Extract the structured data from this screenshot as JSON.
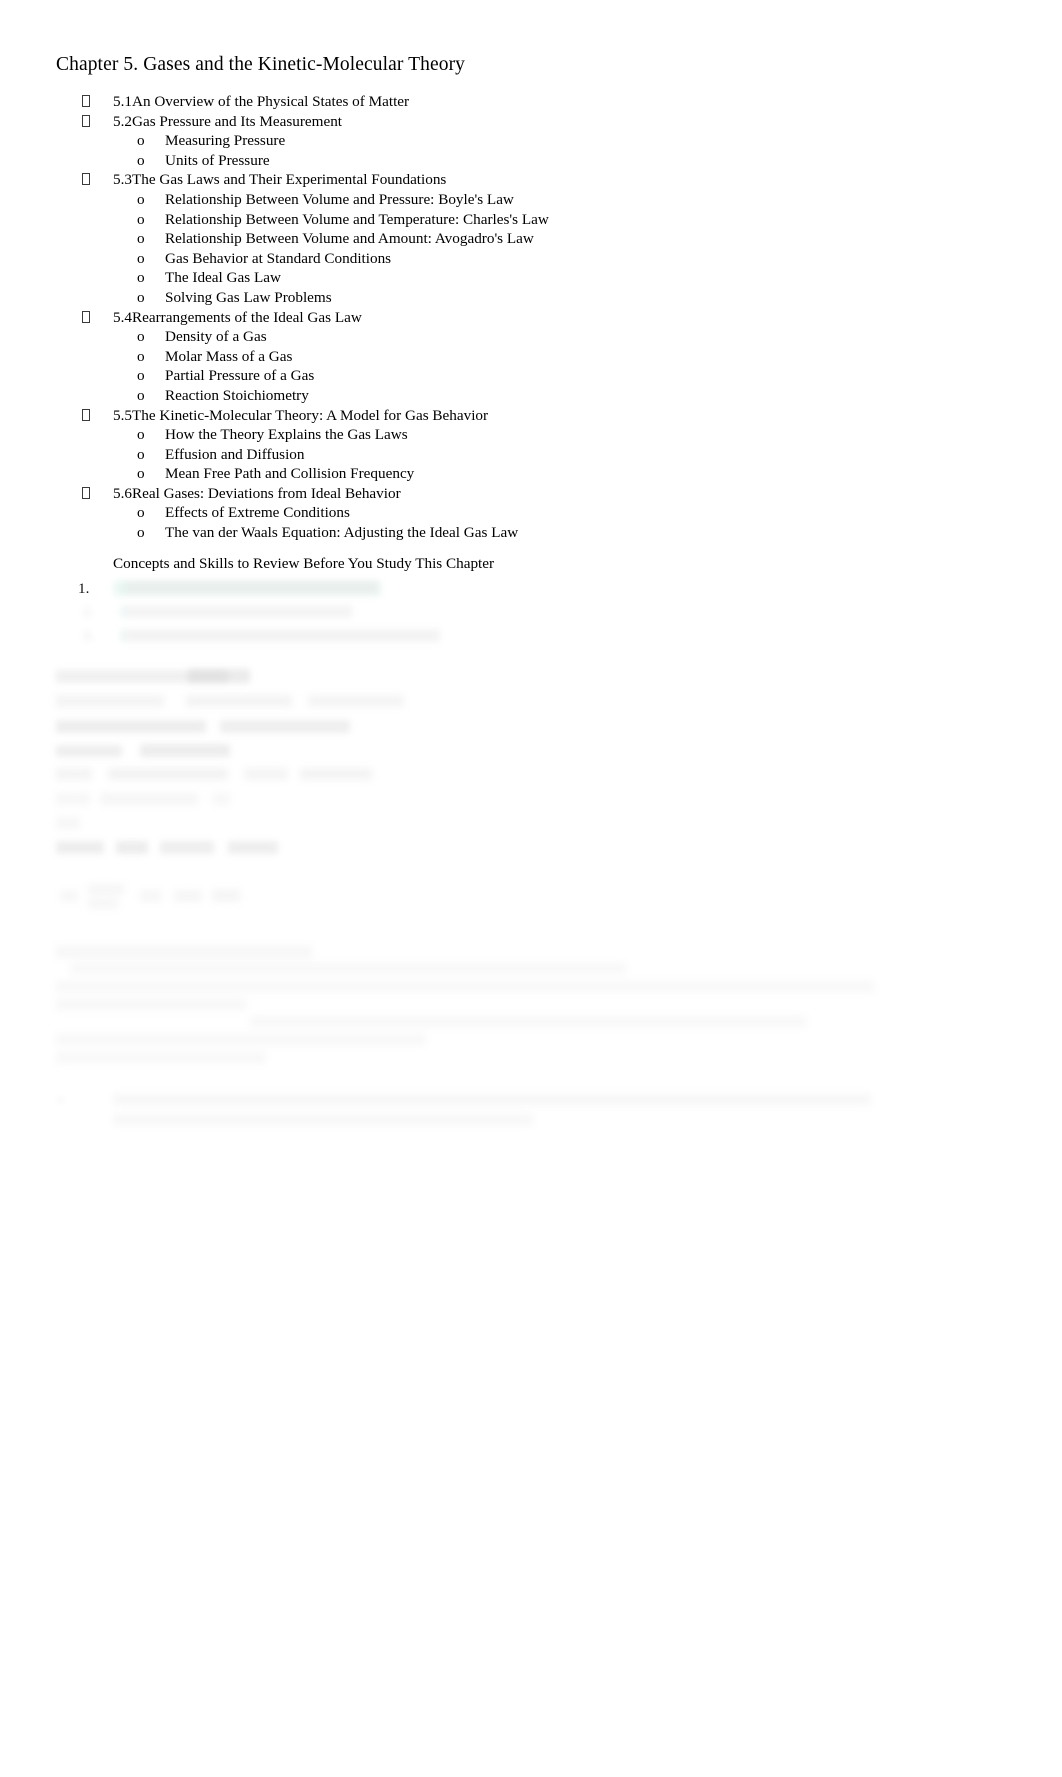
{
  "document": {
    "title": "Chapter 5. Gases and the Kinetic-Molecular Theory",
    "review_heading": "Concepts and Skills to Review Before You Study This Chapter",
    "highlight_color": "#d8f0ea",
    "text_color": "#000000",
    "background_color": "#ffffff"
  },
  "outline": [
    {
      "level": 1,
      "marker": "tofu-box",
      "text": "5.1An Overview of the Physical States of Matter"
    },
    {
      "level": 1,
      "marker": "tofu-box",
      "text": "5.2Gas Pressure and Its Measurement"
    },
    {
      "level": 2,
      "marker": "o",
      "text": "Measuring Pressure"
    },
    {
      "level": 2,
      "marker": "o",
      "text": "Units of Pressure"
    },
    {
      "level": 1,
      "marker": "tofu-box",
      "text": "5.3The Gas Laws and Their Experimental Foundations"
    },
    {
      "level": 2,
      "marker": "o",
      "text": "Relationship Between Volume and Pressure: Boyle's Law"
    },
    {
      "level": 2,
      "marker": "o",
      "text": "Relationship Between Volume and Temperature: Charles's Law"
    },
    {
      "level": 2,
      "marker": "o",
      "text": "Relationship Between Volume and Amount: Avogadro's Law"
    },
    {
      "level": 2,
      "marker": "o",
      "text": "Gas Behavior at Standard Conditions"
    },
    {
      "level": 2,
      "marker": "o",
      "text": "The Ideal Gas Law"
    },
    {
      "level": 2,
      "marker": "o",
      "text": "Solving Gas Law Problems"
    },
    {
      "level": 1,
      "marker": "tofu-box",
      "text": "5.4Rearrangements of the Ideal Gas Law"
    },
    {
      "level": 2,
      "marker": "o",
      "text": "Density of a Gas"
    },
    {
      "level": 2,
      "marker": "o",
      "text": "Molar Mass of a Gas"
    },
    {
      "level": 2,
      "marker": "o",
      "text": "Partial Pressure of a Gas"
    },
    {
      "level": 2,
      "marker": "o",
      "text": "Reaction Stoichiometry"
    },
    {
      "level": 1,
      "marker": "tofu-box",
      "text": "5.5The Kinetic-Molecular Theory: A Model for Gas Behavior"
    },
    {
      "level": 2,
      "marker": "o",
      "text": "How the Theory Explains the Gas Laws"
    },
    {
      "level": 2,
      "marker": "o",
      "text": "Effusion and Diffusion"
    },
    {
      "level": 2,
      "marker": "o",
      "text": "Mean Free Path and Collision Frequency"
    },
    {
      "level": 1,
      "marker": "tofu-box",
      "text": "5.6Real Gases: Deviations from Ideal Behavior"
    },
    {
      "level": 2,
      "marker": "o",
      "text": "Effects of Extreme Conditions"
    },
    {
      "level": 2,
      "marker": "o",
      "text": "The van der Waals Equation: Adjusting the Ideal Gas Law"
    }
  ],
  "redacted_region": {
    "note": "Content below the review heading is blurred/obscured and illegible in the screenshot.",
    "list_number": "1.",
    "illegible_placeholder": ""
  }
}
